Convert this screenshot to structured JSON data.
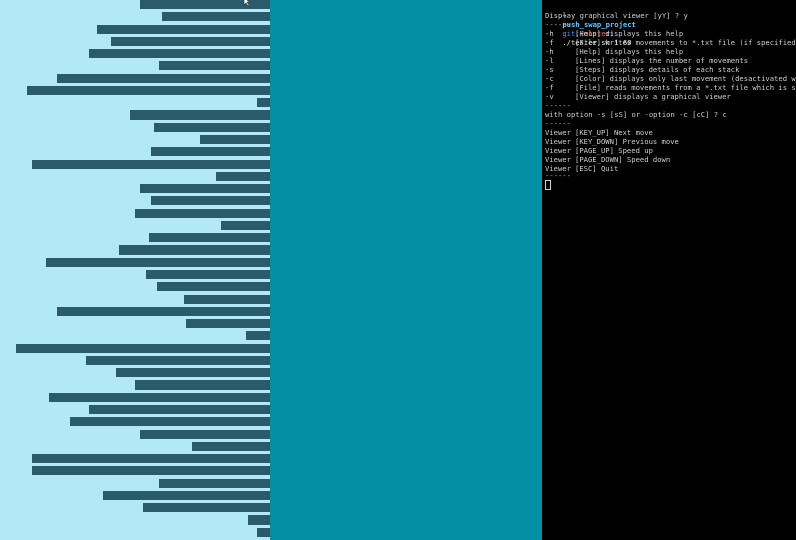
{
  "prompt": {
    "arrow": "➜",
    "dir": "push_swap_project",
    "git_label": "git:(",
    "branch": "master",
    "git_close": ")",
    "command": "./tester.sh 1 60"
  },
  "display_question": "Display graphical viewer [yY] ? y",
  "separator": "------",
  "help_lines": [
    {
      "flag": "-h",
      "desc": "[Help] displays this help"
    },
    {
      "flag": "-f",
      "desc": "[File] writes movements to *.txt file (if specified)"
    },
    {
      "flag": "-h",
      "desc": "[Help] displays this help"
    },
    {
      "flag": "-l",
      "desc": "[Lines] displays the number of movements"
    },
    {
      "flag": "-s",
      "desc": "[Steps] displays details of each stack"
    },
    {
      "flag": "-c",
      "desc": "[Color] displays only last movement (desactivated with -s)"
    },
    {
      "flag": "-f",
      "desc": "[File] reads movements from a *.txt file which is specified"
    },
    {
      "flag": "-v",
      "desc": "[Viewer] displays a graphical viewer"
    }
  ],
  "option_question": "with option -s [sS] or -option -c [cC] ? c",
  "viewer_lines": [
    {
      "label": "Viewer",
      "desc": "[KEY_UP] Next move"
    },
    {
      "label": "Viewer",
      "desc": "[KEY_DOWN] Previous move"
    },
    {
      "label": "Viewer",
      "desc": "[PAGE_UP] Speed up"
    },
    {
      "label": "Viewer",
      "desc": "[PAGE_DOWN] Speed down"
    },
    {
      "label": "Viewer",
      "desc": "[ESC] Quit"
    }
  ],
  "stack_a_values": [
    48,
    40,
    64,
    59,
    67,
    41,
    79,
    90,
    5,
    52,
    43,
    26,
    44,
    88,
    20,
    48,
    44,
    50,
    18,
    45,
    56,
    83,
    46,
    42,
    32,
    79,
    31,
    9,
    94,
    68,
    57,
    50,
    82,
    67,
    74,
    48,
    29,
    88,
    88,
    41,
    62,
    47,
    8,
    5
  ],
  "stack_a_max": 100,
  "colors": {
    "stack_a_bg": "#b3e8f9",
    "bar": "#2a5b6c",
    "stack_b_bg": "#0390a5",
    "terminal_bg": "#000000",
    "prompt_arrow": "#4fd26a",
    "prompt_dir": "#5fc8ff",
    "git": "#5a8cff",
    "branch": "#ff6464"
  }
}
